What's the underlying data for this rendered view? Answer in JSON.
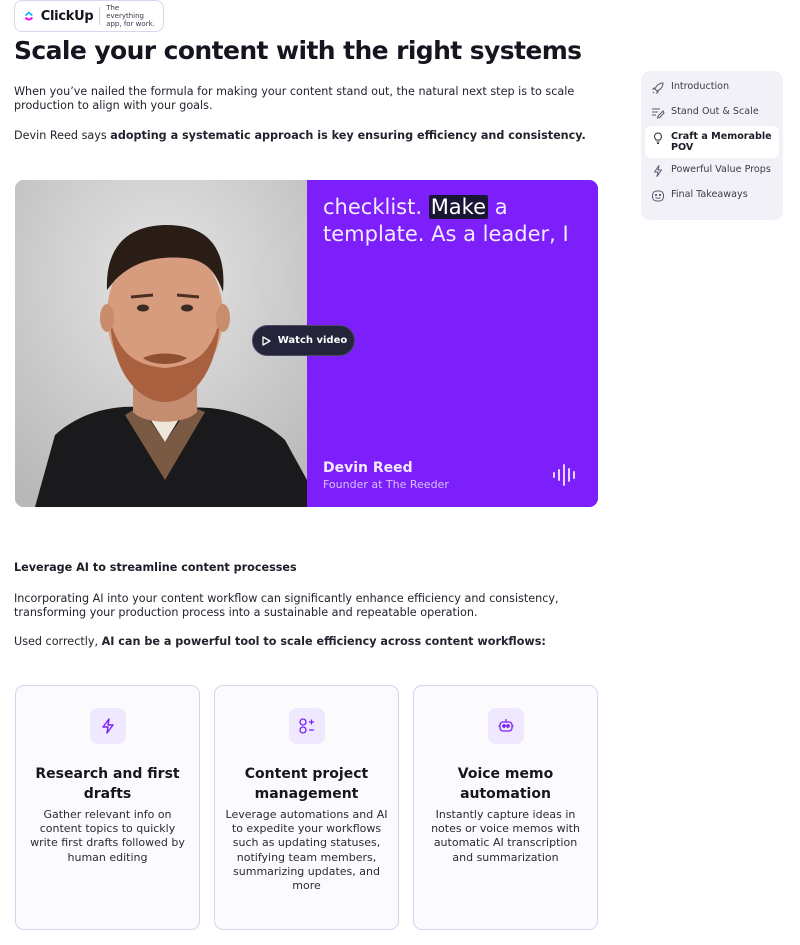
{
  "logo": {
    "word": "ClickUp",
    "tagline": "The everything app, for work."
  },
  "article": {
    "title": "Scale your content with the right systems",
    "intro": "When you’ve nailed the formula for making your content stand out, the natural next step is to scale production to align with your goals.",
    "quote_prefix": "Devin Reed says ",
    "quote_bold": "adopting a systematic approach is key ensuring efficiency and consistency.",
    "subheading": "Leverage AI to streamline content processes",
    "body": "Incorporating AI into your content workflow can significantly enhance efficiency and consistency, transforming your production process into a sustainable and repeatable operation.",
    "used_prefix": "Used correctly, ",
    "used_bold": "AI can be a powerful tool to scale efficiency across content workflows:"
  },
  "video": {
    "caption_before": "checklist. ",
    "caption_highlight": "Make",
    "caption_after": " a template. As a leader, I",
    "watch_label": "Watch video",
    "speaker_name": "Devin Reed",
    "speaker_role": "Founder at The Reeder",
    "accent": "#7d1ffa"
  },
  "cards": [
    {
      "icon": "lightning-icon",
      "title": "Research and first drafts",
      "text": "Gather relevant info on content topics to quickly write first drafts followed by human editing"
    },
    {
      "icon": "shapes-plus-minus-icon",
      "title": "Content project management",
      "text": "Leverage automations and AI to expedite your workflows such as updating statuses, notifying team members, summarizing updates, and more"
    },
    {
      "icon": "robot-icon",
      "title": "Voice memo automation",
      "text": "Instantly capture ideas in notes or voice memos with automatic AI transcription and summarization"
    }
  ],
  "toc": {
    "items": [
      {
        "label": "Introduction",
        "icon": "rocket-icon"
      },
      {
        "label": "Stand Out & Scale",
        "icon": "list-pen-icon"
      },
      {
        "label": "Craft a Memorable POV",
        "icon": "lightbulb-icon",
        "active": true
      },
      {
        "label": "Powerful Value Props",
        "icon": "lightning-icon"
      },
      {
        "label": "Final Takeaways",
        "icon": "chat-face-icon"
      }
    ]
  }
}
